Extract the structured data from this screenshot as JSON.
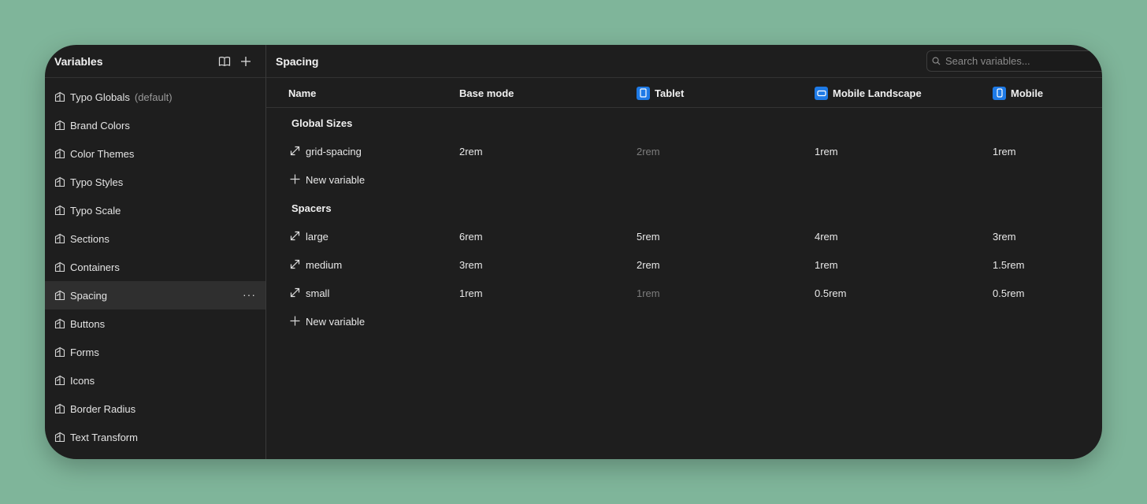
{
  "sidebar": {
    "title": "Variables",
    "items": [
      {
        "label": "Typo Globals",
        "suffix": "(default)"
      },
      {
        "label": "Brand Colors"
      },
      {
        "label": "Color Themes"
      },
      {
        "label": "Typo Styles"
      },
      {
        "label": "Typo Scale"
      },
      {
        "label": "Sections"
      },
      {
        "label": "Containers"
      },
      {
        "label": "Spacing"
      },
      {
        "label": "Buttons"
      },
      {
        "label": "Forms"
      },
      {
        "label": "Icons"
      },
      {
        "label": "Border Radius"
      },
      {
        "label": "Text Transform"
      }
    ],
    "active_index": 7,
    "more_label": "···"
  },
  "main": {
    "title": "Spacing",
    "search": {
      "placeholder": "Search variables..."
    },
    "columns": {
      "name": "Name",
      "base": "Base mode",
      "tablet": "Tablet",
      "mobile_landscape": "Mobile Landscape",
      "mobile": "Mobile"
    },
    "groups": [
      {
        "label": "Global Sizes",
        "rows": [
          {
            "name": "grid-spacing",
            "base": "2rem",
            "tablet": "2rem",
            "mobile_landscape": "1rem",
            "mobile": "1rem"
          }
        ],
        "new_label": "New variable"
      },
      {
        "label": "Spacers",
        "rows": [
          {
            "name": "large",
            "base": "6rem",
            "tablet": "5rem",
            "mobile_landscape": "4rem",
            "mobile": "3rem"
          },
          {
            "name": "medium",
            "base": "3rem",
            "tablet": "2rem",
            "mobile_landscape": "1rem",
            "mobile": "1.5rem"
          },
          {
            "name": "small",
            "base": "1rem",
            "tablet": "1rem",
            "mobile_landscape": "0.5rem",
            "mobile": "0.5rem"
          }
        ],
        "new_label": "New variable"
      }
    ]
  },
  "colors": {
    "background": "#7fb59a",
    "panel": "#1e1e1e",
    "accent": "#1e7ae6",
    "inherited_text": "#7d7d7d"
  }
}
